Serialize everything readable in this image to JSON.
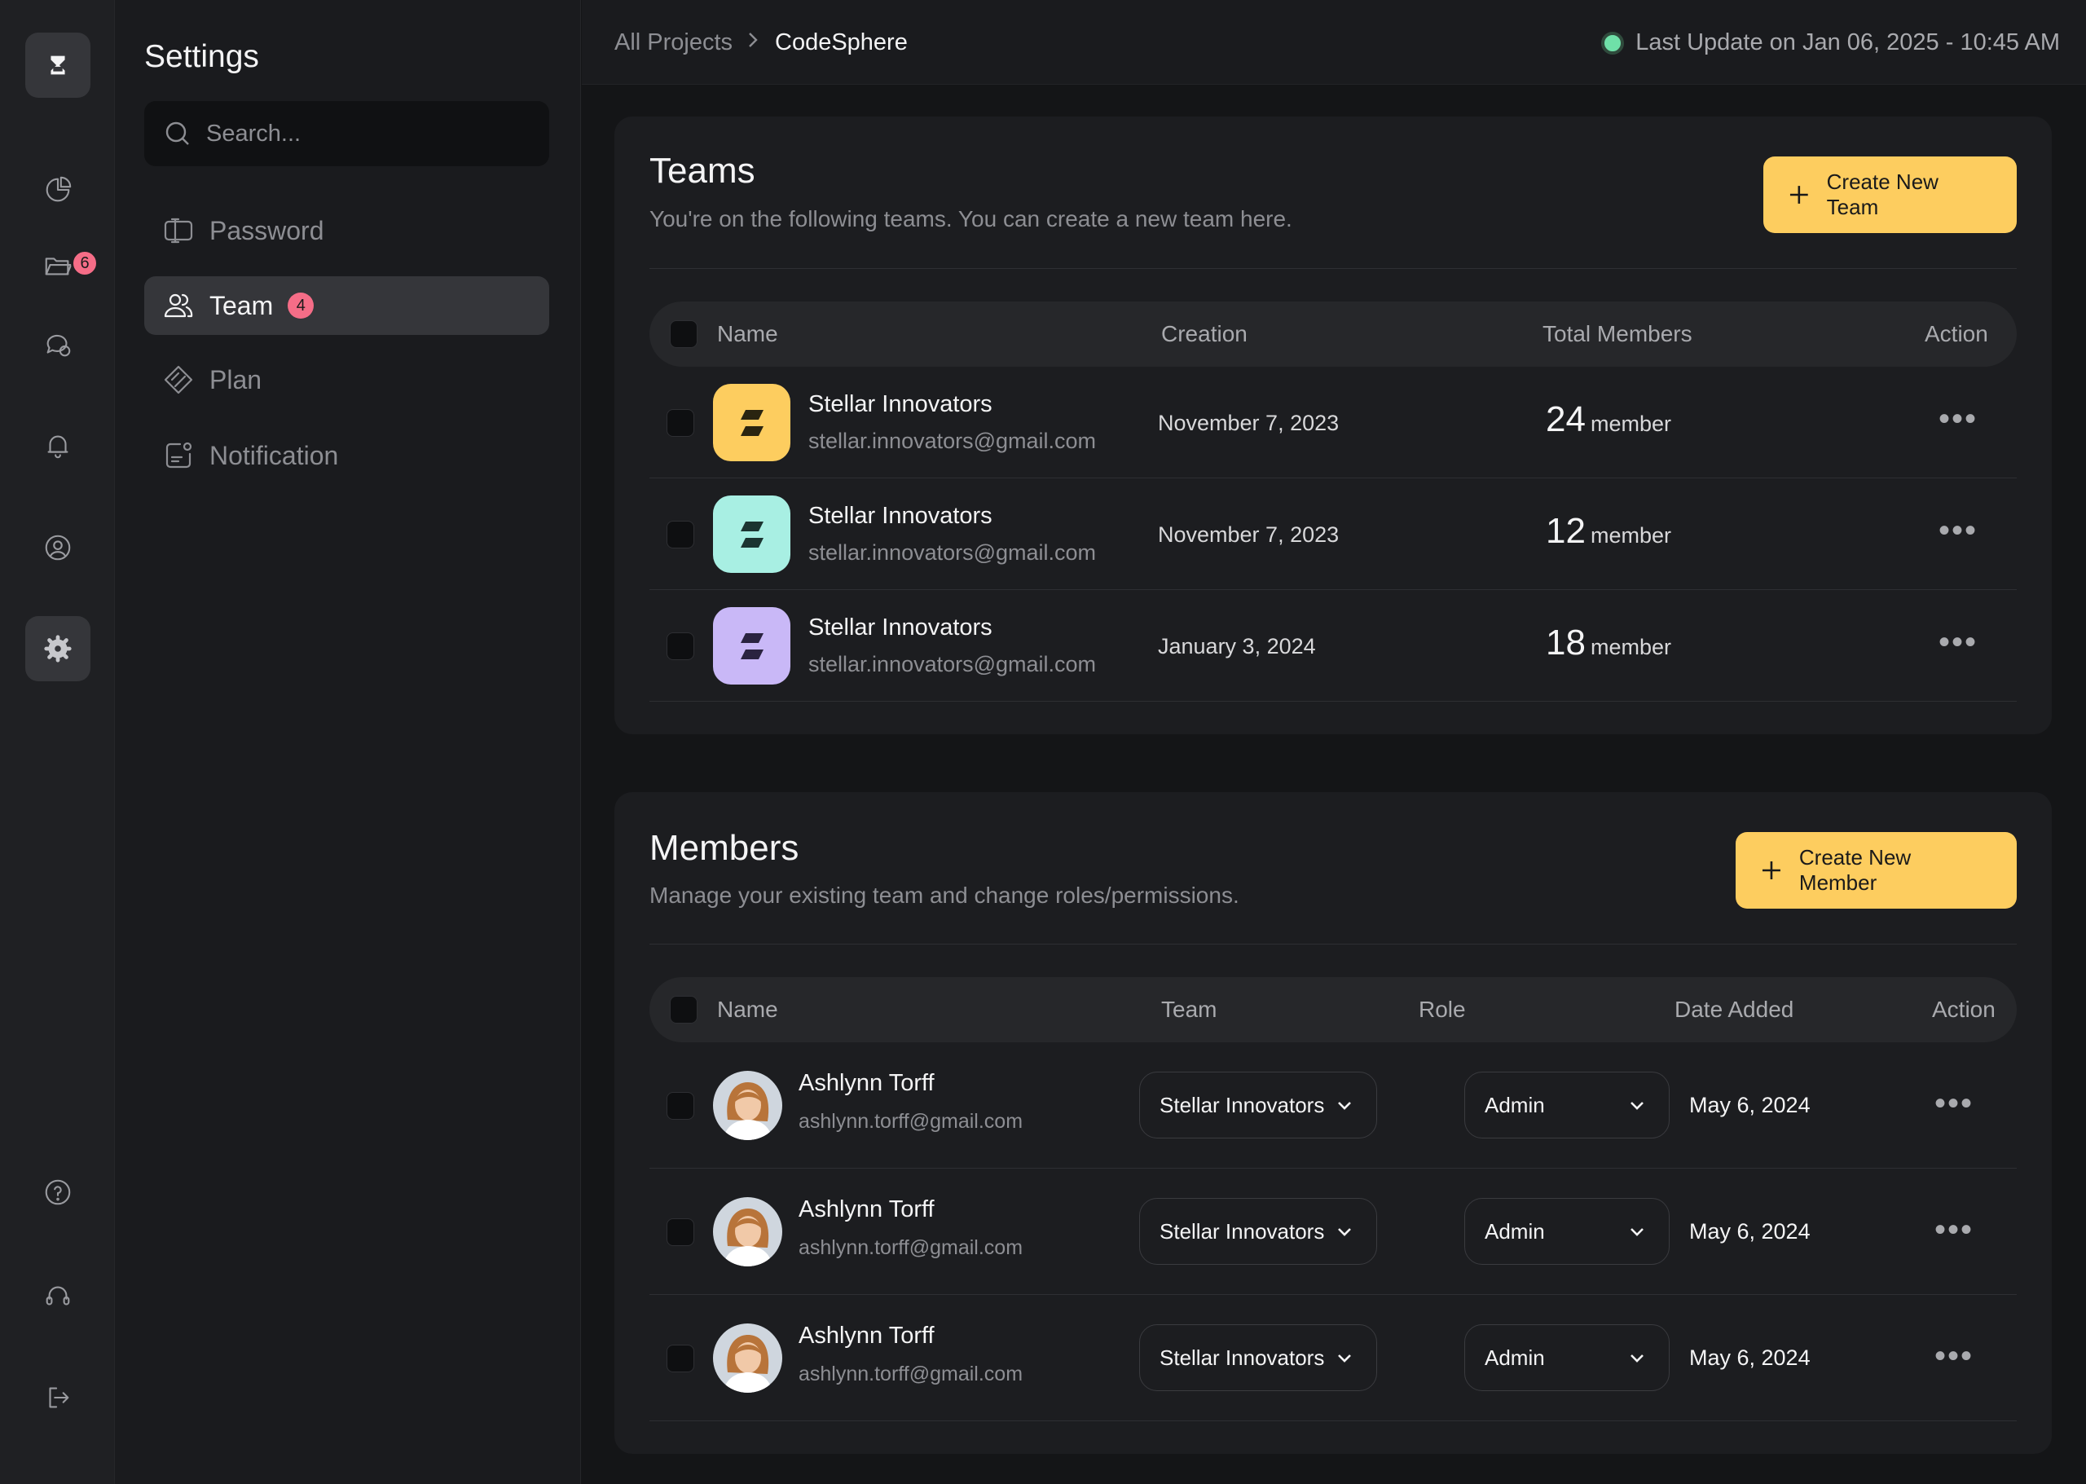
{
  "app": {
    "panel_title": "Settings",
    "search_placeholder": "Search..."
  },
  "rail": {
    "items": [
      {
        "icon": "hourglass-icon"
      },
      {
        "icon": "pie-chart-icon"
      },
      {
        "icon": "folder-icon",
        "badge": "6"
      },
      {
        "icon": "chat-icon"
      },
      {
        "icon": "bell-icon"
      },
      {
        "icon": "user-circle-icon"
      },
      {
        "icon": "gear-icon"
      },
      {
        "icon": "help-icon"
      },
      {
        "icon": "headset-icon"
      },
      {
        "icon": "logout-icon"
      }
    ]
  },
  "nav": {
    "items": [
      {
        "label": "Password",
        "icon": "password-icon"
      },
      {
        "label": "Team",
        "icon": "users-icon",
        "badge": "4",
        "active": true
      },
      {
        "label": "Plan",
        "icon": "ticket-icon"
      },
      {
        "label": "Notification",
        "icon": "notification-icon"
      }
    ]
  },
  "header": {
    "crumb_parent": "All Projects",
    "crumb_current": "CodeSphere",
    "status": "Last Update on Jan 06, 2025 - 10:45 AM"
  },
  "teams": {
    "title": "Teams",
    "subtitle": "You're on the following teams. You can create a new team here.",
    "create_label": "Create New Team",
    "columns": [
      "Name",
      "Creation",
      "Total Members",
      "Action"
    ],
    "rows": [
      {
        "name": "Stellar Innovators",
        "email": "stellar.innovators@gmail.com",
        "created": "November 7, 2023",
        "count": "24",
        "unit": "member",
        "color": "#fdcd5f"
      },
      {
        "name": "Stellar Innovators",
        "email": "stellar.innovators@gmail.com",
        "created": "November 7, 2023",
        "count": "12",
        "unit": "member",
        "color": "#a8efe3"
      },
      {
        "name": "Stellar Innovators",
        "email": "stellar.innovators@gmail.com",
        "created": "January 3, 2024",
        "count": "18",
        "unit": "member",
        "color": "#c9b8f7"
      }
    ]
  },
  "members": {
    "title": "Members",
    "subtitle": "Manage your existing team and change roles/permissions.",
    "create_label": "Create New Member",
    "columns": [
      "Name",
      "Team",
      "Role",
      "Date Added",
      "Action"
    ],
    "rows": [
      {
        "name": "Ashlynn Torff",
        "email": "ashlynn.torff@gmail.com",
        "team": "Stellar Innovators",
        "role": "Admin",
        "date": "May 6, 2024"
      },
      {
        "name": "Ashlynn Torff",
        "email": "ashlynn.torff@gmail.com",
        "team": "Stellar Innovators",
        "role": "Admin",
        "date": "May 6, 2024"
      },
      {
        "name": "Ashlynn Torff",
        "email": "ashlynn.torff@gmail.com",
        "team": "Stellar Innovators",
        "role": "Admin",
        "date": "May 6, 2024"
      }
    ]
  },
  "colors": {
    "accent": "#fdcd5f",
    "badge": "#f56d87",
    "status_dot": "#6fe0a8"
  }
}
